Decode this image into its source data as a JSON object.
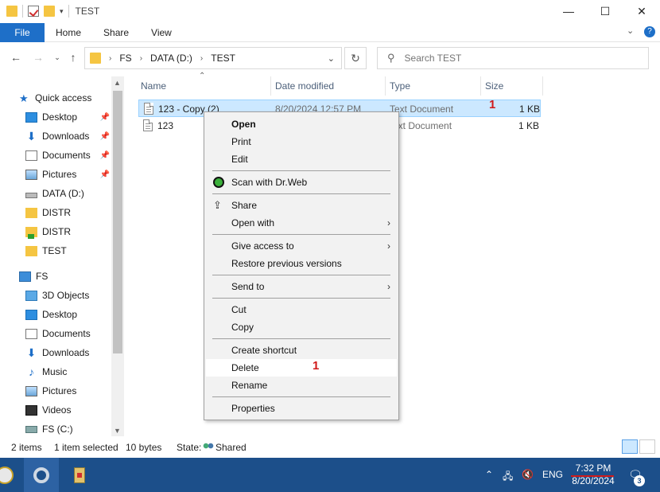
{
  "window": {
    "title": "TEST",
    "controls": {
      "minimize": "—",
      "maximize": "☐",
      "close": "✕"
    }
  },
  "ribbon": {
    "file": "File",
    "tabs": [
      "Home",
      "Share",
      "View"
    ]
  },
  "address": {
    "crumbs": [
      "FS",
      "DATA (D:)",
      "TEST"
    ],
    "search_placeholder": "Search TEST"
  },
  "nav_pane": {
    "quick_access": "Quick access",
    "quick_items": [
      {
        "label": "Desktop",
        "icon": "desktop-icon",
        "pinned": true
      },
      {
        "label": "Downloads",
        "icon": "download-icon",
        "pinned": true
      },
      {
        "label": "Documents",
        "icon": "document-icon",
        "pinned": true
      },
      {
        "label": "Pictures",
        "icon": "pictures-icon",
        "pinned": true
      },
      {
        "label": "DATA (D:)",
        "icon": "drive-icon",
        "pinned": false
      },
      {
        "label": "DISTR",
        "icon": "folder-icon",
        "pinned": false
      },
      {
        "label": "DISTR",
        "icon": "shared-folder-icon",
        "pinned": false
      },
      {
        "label": "TEST",
        "icon": "folder-icon",
        "pinned": false
      }
    ],
    "this_pc": "FS",
    "pc_items": [
      {
        "label": "3D Objects",
        "icon": "3d-objects-icon"
      },
      {
        "label": "Desktop",
        "icon": "desktop-icon"
      },
      {
        "label": "Documents",
        "icon": "document-icon"
      },
      {
        "label": "Downloads",
        "icon": "download-icon"
      },
      {
        "label": "Music",
        "icon": "music-icon"
      },
      {
        "label": "Pictures",
        "icon": "pictures-icon"
      },
      {
        "label": "Videos",
        "icon": "video-icon"
      },
      {
        "label": "FS (C:)",
        "icon": "drive-icon"
      }
    ]
  },
  "columns": {
    "name": "Name",
    "date": "Date modified",
    "type": "Type",
    "size": "Size"
  },
  "files": [
    {
      "name": "123 - Copy (2)",
      "date": "8/20/2024 12:57 PM",
      "type": "Text Document",
      "size": "1 KB",
      "selected": true
    },
    {
      "name": "123",
      "date": "",
      "type": "ext Document",
      "size": "1 KB",
      "selected": false
    }
  ],
  "annotations": {
    "mark1": "1",
    "mark2": "1"
  },
  "context_menu": {
    "open": "Open",
    "print": "Print",
    "edit": "Edit",
    "scan": "Scan with Dr.Web",
    "share": "Share",
    "open_with": "Open with",
    "give_access": "Give access to",
    "restore": "Restore previous versions",
    "send_to": "Send to",
    "cut": "Cut",
    "copy": "Copy",
    "create_shortcut": "Create shortcut",
    "delete": "Delete",
    "rename": "Rename",
    "properties": "Properties"
  },
  "status": {
    "items": "2 items",
    "selected": "1 item selected",
    "bytes": "10 bytes",
    "state_label": "State:",
    "state_value": "Shared"
  },
  "taskbar": {
    "lang": "ENG",
    "time": "7:32 PM",
    "date": "8/20/2024",
    "notifications": "3"
  },
  "colors": {
    "accent": "#1e6fc8",
    "taskbar": "#1c4f8a",
    "selection": "#cce8ff",
    "annotation": "#d11a1a"
  }
}
